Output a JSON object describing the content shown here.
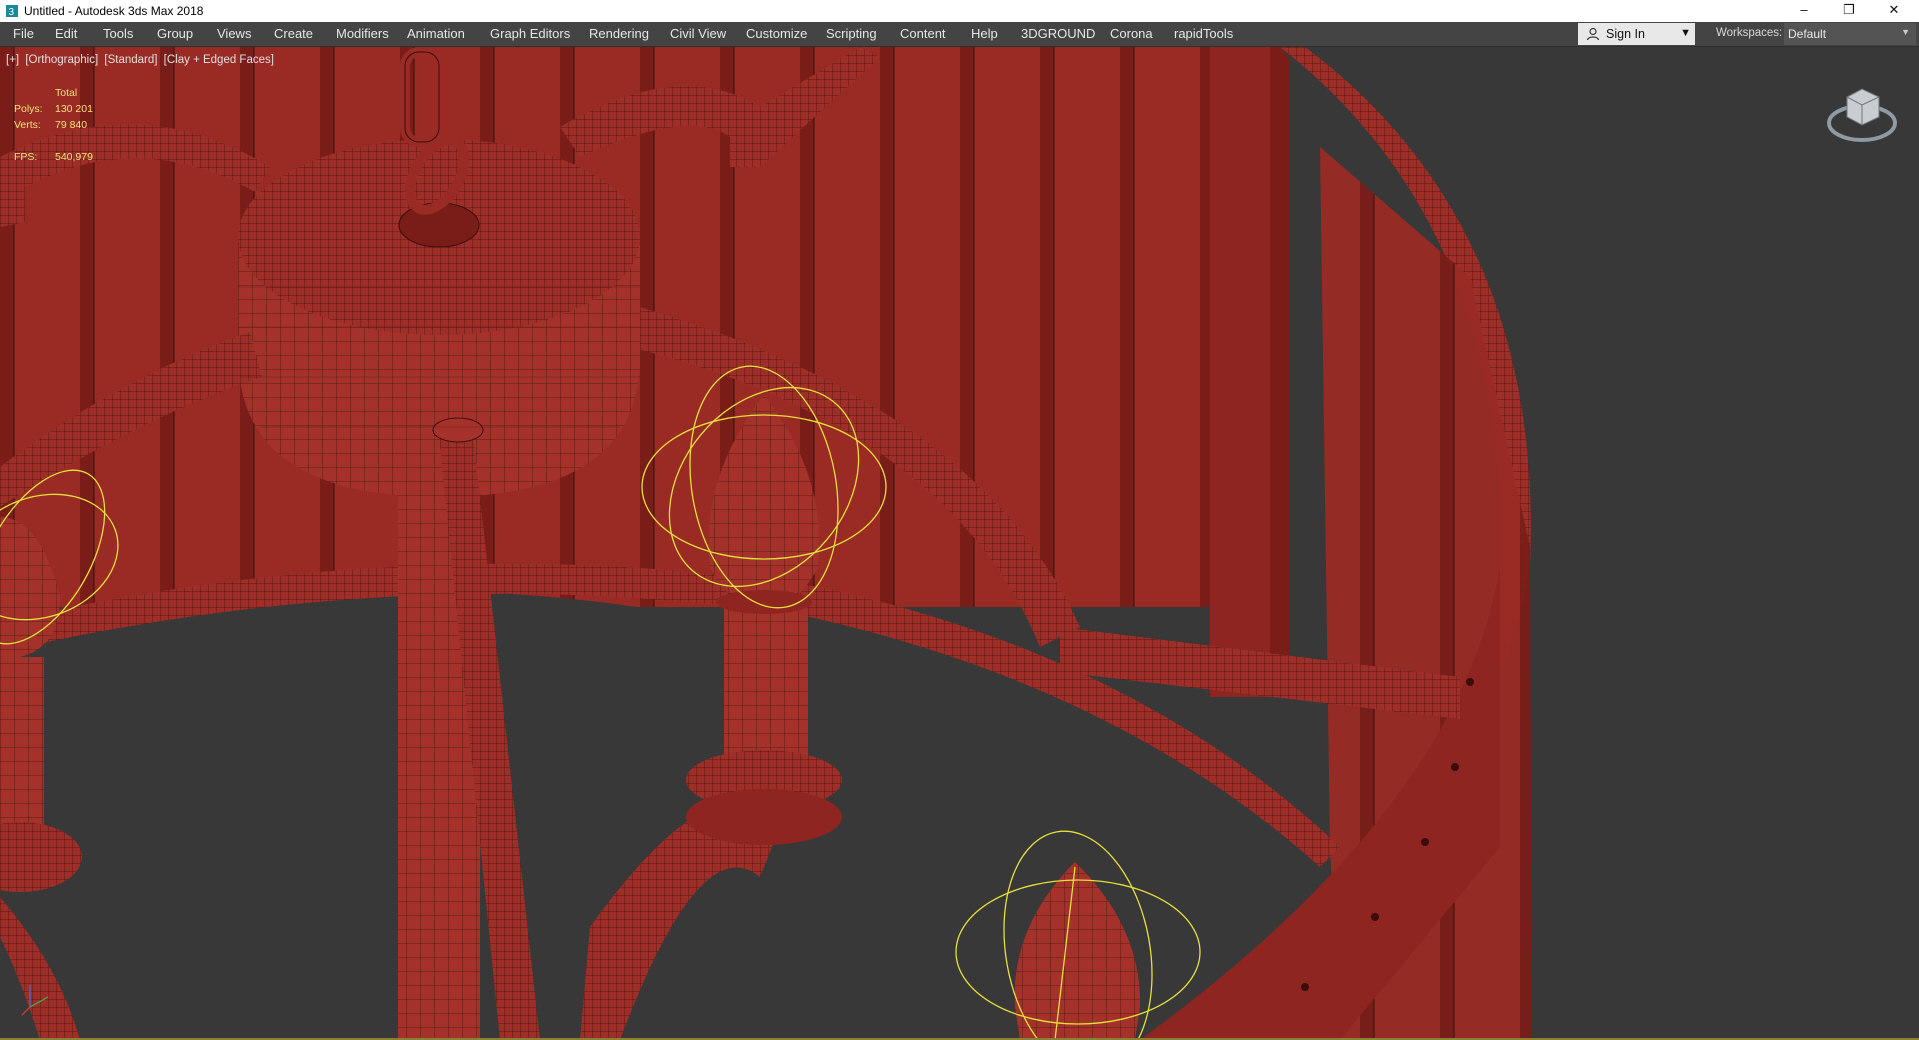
{
  "window": {
    "title": "Untitled - Autodesk 3ds Max 2018",
    "controls": {
      "minimize": "–",
      "restore": "❐",
      "close": "✕"
    }
  },
  "menu": {
    "items": [
      "File",
      "Edit",
      "Tools",
      "Group",
      "Views",
      "Create",
      "Modifiers",
      "Animation",
      "Graph Editors",
      "Rendering",
      "Civil View",
      "Customize",
      "Scripting",
      "Content",
      "Help",
      "3DGROUND",
      "Corona",
      "rapidTools"
    ]
  },
  "account": {
    "sign_in": "Sign In"
  },
  "workspaces": {
    "label": "Workspaces:",
    "value": "Default"
  },
  "viewport": {
    "labels": {
      "plus": "[+]",
      "projection": "[Orthographic]",
      "style": "[Standard]",
      "shading": "[Clay + Edged Faces]"
    },
    "stats": {
      "header": "Total",
      "polys_label": "Polys:",
      "polys": "130 201",
      "verts_label": "Verts:",
      "verts": "79 840",
      "fps_label": "FPS:",
      "fps": "540,979"
    }
  },
  "colors": {
    "viewport_bg": "#383838",
    "model_red": "#9a2a24",
    "wire_dark": "#3a0d0b",
    "selection_yellow": "#e6e03a",
    "stats_yellow": "#f3e37a"
  },
  "icons": [
    "app-icon",
    "user-icon",
    "viewcube-icon",
    "axis-tripod-icon",
    "chevron-down-icon"
  ]
}
